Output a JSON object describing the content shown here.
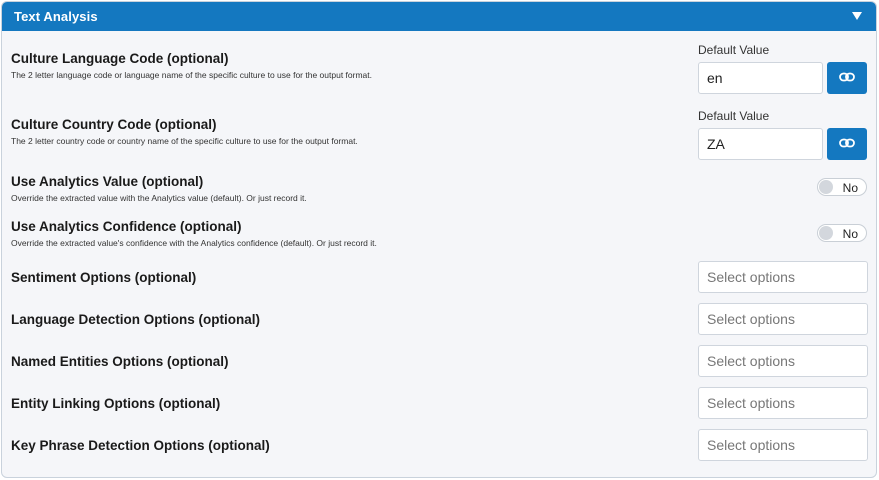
{
  "panel": {
    "title": "Text Analysis"
  },
  "culture_language": {
    "label": "Culture Language Code (optional)",
    "description": "The 2 letter language code or language name of the specific culture to use for the output format.",
    "default_label": "Default Value",
    "value": "en"
  },
  "culture_country": {
    "label": "Culture Country Code (optional)",
    "description": "The 2 letter country code or country name of the specific culture to use for the output format.",
    "default_label": "Default Value",
    "value": "ZA"
  },
  "analytics_value": {
    "label": "Use Analytics Value (optional)",
    "description": "Override the extracted value with the Analytics value (default). Or just record it.",
    "toggle": "No"
  },
  "analytics_confidence": {
    "label": "Use Analytics Confidence (optional)",
    "description": "Override the extracted value's confidence with the Analytics confidence (default). Or just record it.",
    "toggle": "No"
  },
  "options": [
    {
      "label": "Sentiment Options (optional)",
      "placeholder": "Select options"
    },
    {
      "label": "Language Detection Options (optional)",
      "placeholder": "Select options"
    },
    {
      "label": "Named Entities Options (optional)",
      "placeholder": "Select options"
    },
    {
      "label": "Entity Linking Options (optional)",
      "placeholder": "Select options"
    },
    {
      "label": "Key Phrase Detection Options (optional)",
      "placeholder": "Select options"
    }
  ],
  "colors": {
    "accent": "#1478c0",
    "background": "#f5f6f9"
  },
  "icons": {
    "collapse": "triangle-down-icon",
    "link": "link-icon"
  }
}
